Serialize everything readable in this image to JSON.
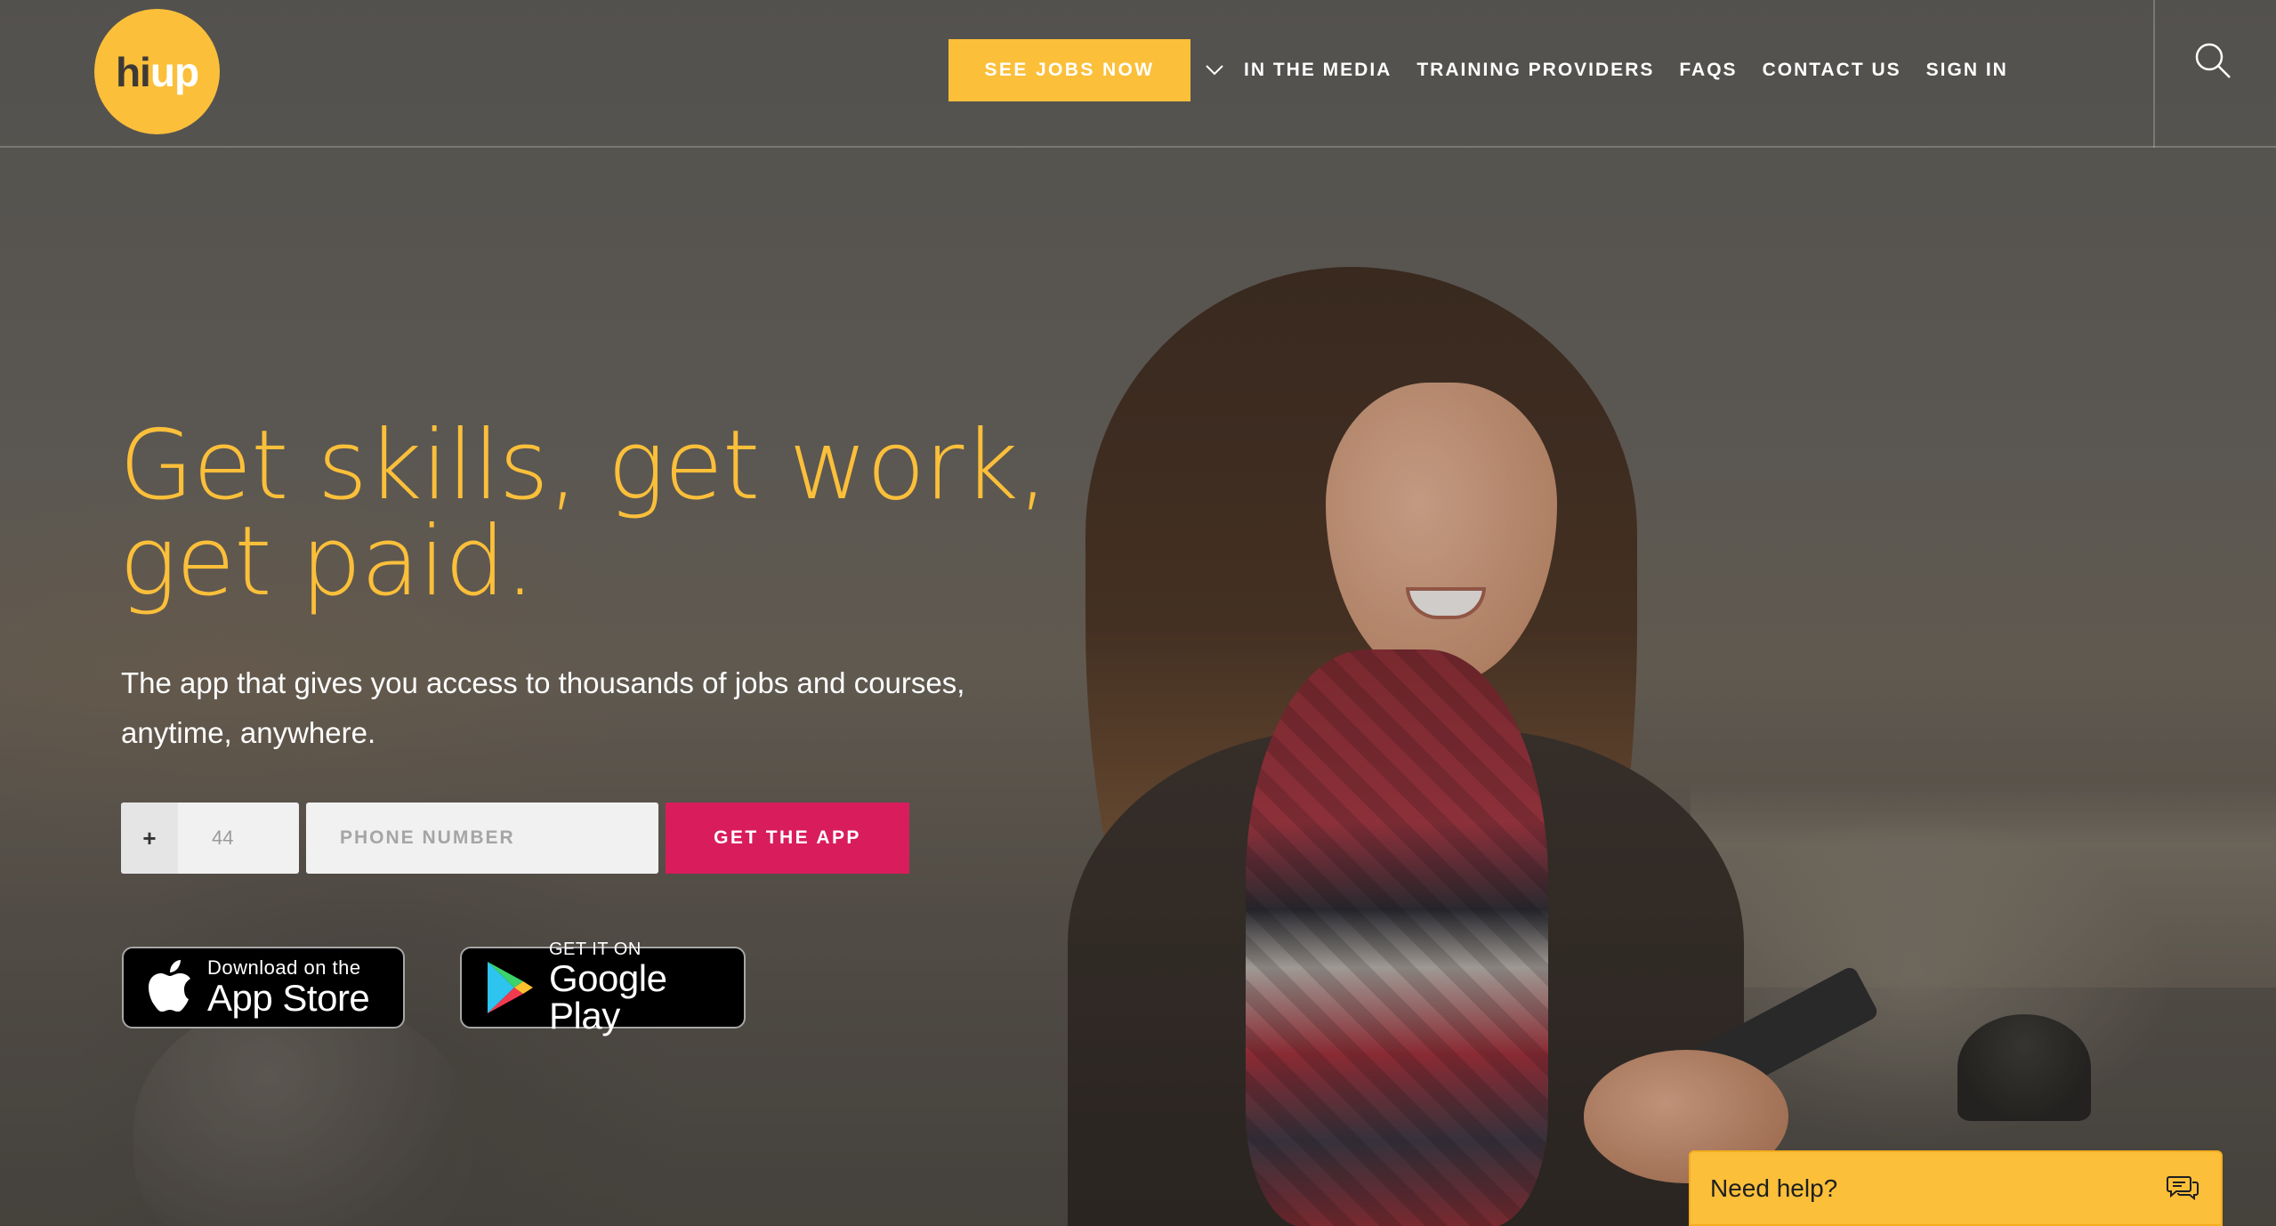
{
  "brand": {
    "logo_hi": "hi",
    "logo_up": "up",
    "accent_yellow": "#fbbf3a",
    "accent_pink": "#d91c5c"
  },
  "nav": {
    "cta_label": "SEE JOBS NOW",
    "dropdown_icon": "chevron-down-icon",
    "links": [
      {
        "label": "IN THE MEDIA"
      },
      {
        "label": "TRAINING PROVIDERS"
      },
      {
        "label": "FAQS"
      },
      {
        "label": "CONTACT US"
      },
      {
        "label": "SIGN IN"
      }
    ],
    "search_icon": "search-icon"
  },
  "hero": {
    "title_line1": "Get skills, get work,",
    "title_line2": "get paid.",
    "subtitle_line1": "The app that gives you access to thousands of jobs and courses,",
    "subtitle_line2": "anytime, anywhere."
  },
  "signup_form": {
    "country_code_prefix": "+",
    "country_code_value": "44",
    "phone_placeholder": "PHONE NUMBER",
    "submit_label": "GET THE APP"
  },
  "store_badges": {
    "apple": {
      "small": "Download on the",
      "big": "App Store",
      "icon": "apple-icon"
    },
    "google": {
      "small": "GET IT ON",
      "big": "Google Play",
      "icon": "google-play-icon"
    }
  },
  "help_widget": {
    "label": "Need help?",
    "icon": "chat-bubbles-icon"
  }
}
